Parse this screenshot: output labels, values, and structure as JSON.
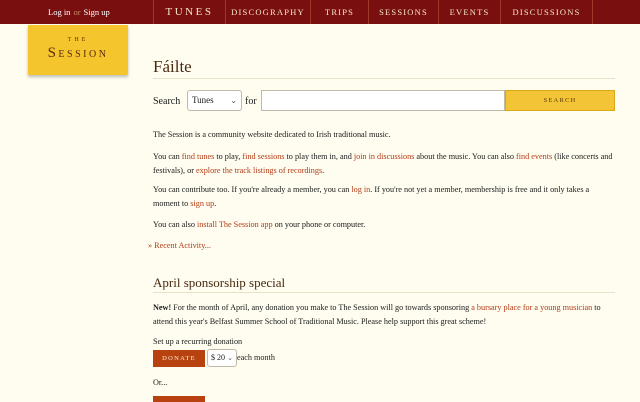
{
  "auth": {
    "login": "Log in",
    "or": "or",
    "signup": "Sign up"
  },
  "nav": [
    "Tunes",
    "Discography",
    "Trips",
    "Sessions",
    "Events",
    "Discussions"
  ],
  "logo": {
    "the": "THE",
    "cap": "S",
    "rest": "ESSION"
  },
  "page": {
    "title": "Fáilte"
  },
  "search": {
    "label": "Search",
    "selected": "Tunes",
    "for": "for",
    "value": "",
    "button": "SEARCH"
  },
  "intro": "The Session is a community website dedicated to Irish traditional music.",
  "p2": {
    "t1": "You can ",
    "l1": "find tunes",
    "t2": " to play, ",
    "l2": "find sessions",
    "t3": " to play them in, and ",
    "l3": "join in discussions",
    "t4": " about the music. You can also ",
    "l4": "find events",
    "t5": " (like concerts and festivals), or ",
    "l5": "explore the track listings of recordings",
    "t6": "."
  },
  "p3": {
    "t1": "You can contribute too. If you're already a member, you can ",
    "l1": "log in",
    "t2": ". If you're not yet a member, membership is free and it only takes a moment to ",
    "l2": "sign up",
    "t3": "."
  },
  "p4": {
    "t1": "You can also ",
    "l1": "install The Session app",
    "t2": " on your phone or computer."
  },
  "recent": "» Recent Activity...",
  "sponsor": {
    "title": "April sponsorship special",
    "new": "New!",
    "t1": " For the month of April, any donation you make to The Session will go towards sponsoring ",
    "l1": "a bursary place for a young musician",
    "t2": " to attend this year's Belfast Summer School of Traditional Music. Please help support this great scheme!",
    "recurring": "Set up a recurring donation",
    "donate": "DONATE",
    "amount": "$ 20",
    "each": " each month",
    "or": "Or..."
  },
  "colors": {
    "topbar": "#7a0f0f",
    "logo": "#f4c52c",
    "link": "#b33a16",
    "button": "#f2c436",
    "donate": "#b8420f",
    "background": "#fefdf0"
  }
}
